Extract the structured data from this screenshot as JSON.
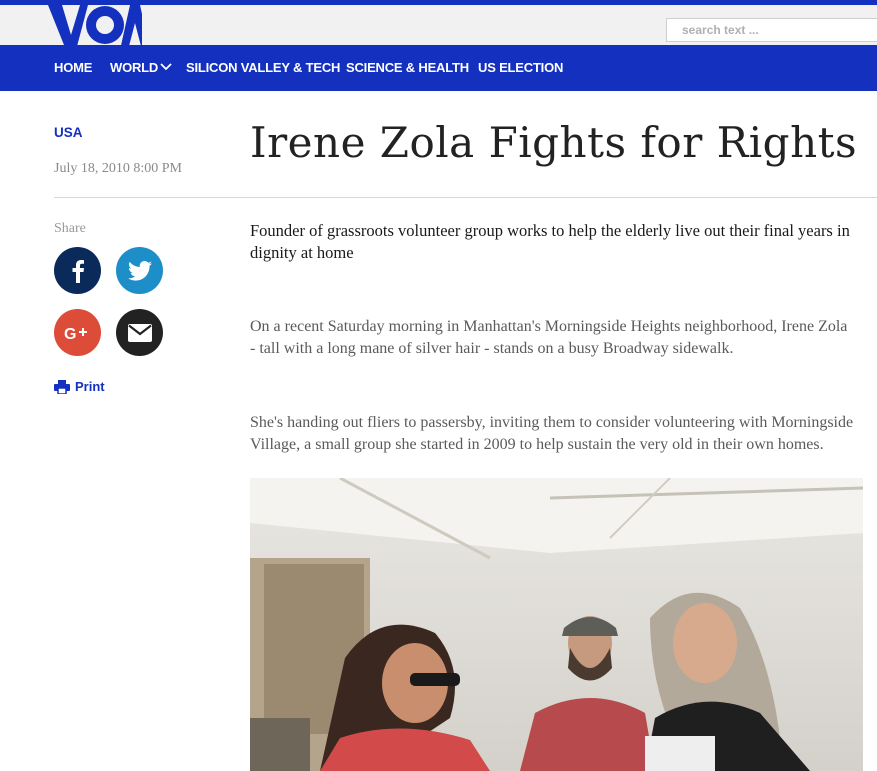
{
  "header": {
    "logo_text": "VOA",
    "search_placeholder": "search text ..."
  },
  "nav": [
    {
      "label": "HOME"
    },
    {
      "label": "WORLD"
    },
    {
      "label": "SILICON VALLEY & TECH"
    },
    {
      "label": "SCIENCE & HEALTH"
    },
    {
      "label": "US ELECTION"
    }
  ],
  "article": {
    "category": "USA",
    "date": "July 18, 2010 8:00 PM",
    "title": "Irene Zola Fights for Rights",
    "share_label": "Share",
    "print_label": "Print",
    "summary": "Founder of grassroots volunteer group works to help the elderly live out their final years in dignity at home",
    "paragraphs": [
      "On a recent Saturday morning in Manhattan's Morningside Heights neighborhood, Irene Zola - tall with a long mane of silver hair - stands on a busy Broadway sidewalk.",
      "She's handing out fliers to passersby, inviting them to consider volunteering with Morningside Village, a small group she started in 2009 to help sustain the very old in their own homes."
    ]
  },
  "share_buttons": [
    {
      "icon": "facebook-icon",
      "color": "#0a2a5a"
    },
    {
      "icon": "twitter-icon",
      "color": "#1e8ec9"
    },
    {
      "icon": "google-plus-icon",
      "color": "#dd4b39"
    },
    {
      "icon": "email-icon",
      "color": "#222222"
    }
  ],
  "colors": {
    "brand_blue": "#1330bf",
    "topbar_gray": "#f1f1f1"
  }
}
